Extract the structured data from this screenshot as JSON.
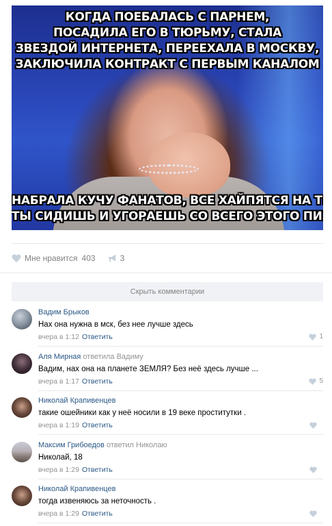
{
  "post": {
    "image": {
      "top_caption": [
        "когда поебалась с парнем,",
        "посадила его в тюрьму, стала",
        "звездой интернета, переехала в москву,",
        "заключила контракт с первым каналом"
      ],
      "bottom_caption": [
        "набрала кучу фанатов, все хайпятся на тебе, а",
        "ты сидишь и угораешь со всего этого пиздеца"
      ]
    },
    "like_label": "Мне нравится",
    "like_count": "403",
    "share_count": "3",
    "hide_comments_label": "Скрыть комментарии",
    "accent_color": "#2a5885"
  },
  "comments": [
    {
      "author": "Вадим Брыков",
      "replied_to": "",
      "text": "Нах она нужна в мск, без нее лучше здесь",
      "time": "вчера в 1:12",
      "reply_label": "Ответить",
      "likes": "1"
    },
    {
      "author": "Аля Мирная",
      "replied_to": "ответила Вадиму",
      "text": "Вадим, нах она на планете ЗЕМЛЯ? Без неё здесь лучше ...",
      "time": "вчера в 1:17",
      "reply_label": "Ответить",
      "likes": "5"
    },
    {
      "author": "Николай Крапивенцев",
      "replied_to": "",
      "text": "такие ошейники как у неё носили в 19 веке проститутки .",
      "time": "вчера в 1:19",
      "reply_label": "Ответить",
      "likes": ""
    },
    {
      "author": "Максим Грибоедов",
      "replied_to": "ответил Николаю",
      "text": "Николай, 18",
      "time": "вчера в 1:29",
      "reply_label": "Ответить",
      "likes": ""
    },
    {
      "author": "Николай Крапивенцев",
      "replied_to": "",
      "text": "тогда извеняюсь за неточность .",
      "time": "вчера в 1:29",
      "reply_label": "Ответить",
      "likes": ""
    }
  ]
}
